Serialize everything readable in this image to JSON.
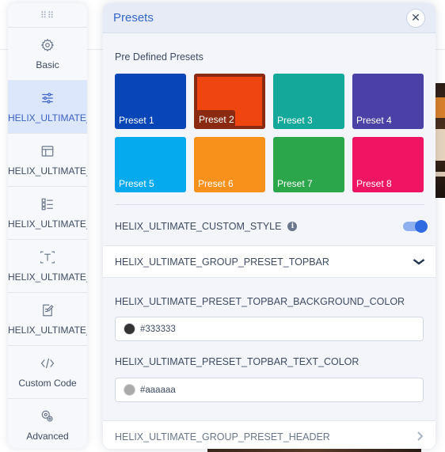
{
  "sidebar": {
    "drag_handle": "⠿⠿",
    "items": [
      {
        "label": "Basic",
        "icon": "gear-icon",
        "active": false
      },
      {
        "label": "HELIX_ULTIMATE_PRES",
        "icon": "sliders-icon",
        "active": true
      },
      {
        "label": "HELIX_ULTIMATE_LAYO",
        "icon": "layout-icon",
        "active": false
      },
      {
        "label": "HELIX_ULTIMATE_NAVI",
        "icon": "menu-list-icon",
        "active": false
      },
      {
        "label": "HELIX_ULTIMATE_TYPO",
        "icon": "typography-icon",
        "active": false
      },
      {
        "label": "HELIX_ULTIMATE_BLOG",
        "icon": "edit-document-icon",
        "active": false
      },
      {
        "label": "Custom Code",
        "icon": "code-icon",
        "active": false
      },
      {
        "label": "Advanced",
        "icon": "settings-advanced-icon",
        "active": false
      }
    ]
  },
  "panel": {
    "title": "Presets",
    "close_label": "✕",
    "predefined_label": "Pre Defined Presets",
    "presets": [
      {
        "label": "Preset 1",
        "color": "#0846b8",
        "selected": false
      },
      {
        "label": "Preset 2",
        "color": "#ee4511",
        "selected": true
      },
      {
        "label": "Preset 3",
        "color": "#13a89a",
        "selected": false
      },
      {
        "label": "Preset 4",
        "color": "#4b40a6",
        "selected": false
      },
      {
        "label": "Preset 5",
        "color": "#05aaee",
        "selected": false
      },
      {
        "label": "Preset 6",
        "color": "#f7911b",
        "selected": false
      },
      {
        "label": "Preset 7",
        "color": "#2ca64a",
        "selected": false
      },
      {
        "label": "Preset 8",
        "color": "#ef1563",
        "selected": false
      }
    ],
    "custom_style_label": "HELIX_ULTIMATE_CUSTOM_STYLE",
    "custom_style_enabled": true,
    "group_topbar_label": "HELIX_ULTIMATE_GROUP_PRESET_TOPBAR",
    "topbar_bg_label": "HELIX_ULTIMATE_PRESET_TOPBAR_BACKGROUND_COLOR",
    "topbar_bg_value": "#333333",
    "topbar_text_label": "HELIX_ULTIMATE_PRESET_TOPBAR_TEXT_COLOR",
    "topbar_text_value": "#aaaaaa",
    "group_header_label": "HELIX_ULTIMATE_GROUP_PRESET_HEADER"
  },
  "colors": {
    "accent": "#3566c9",
    "toggle_on": "#2f6ae0"
  }
}
